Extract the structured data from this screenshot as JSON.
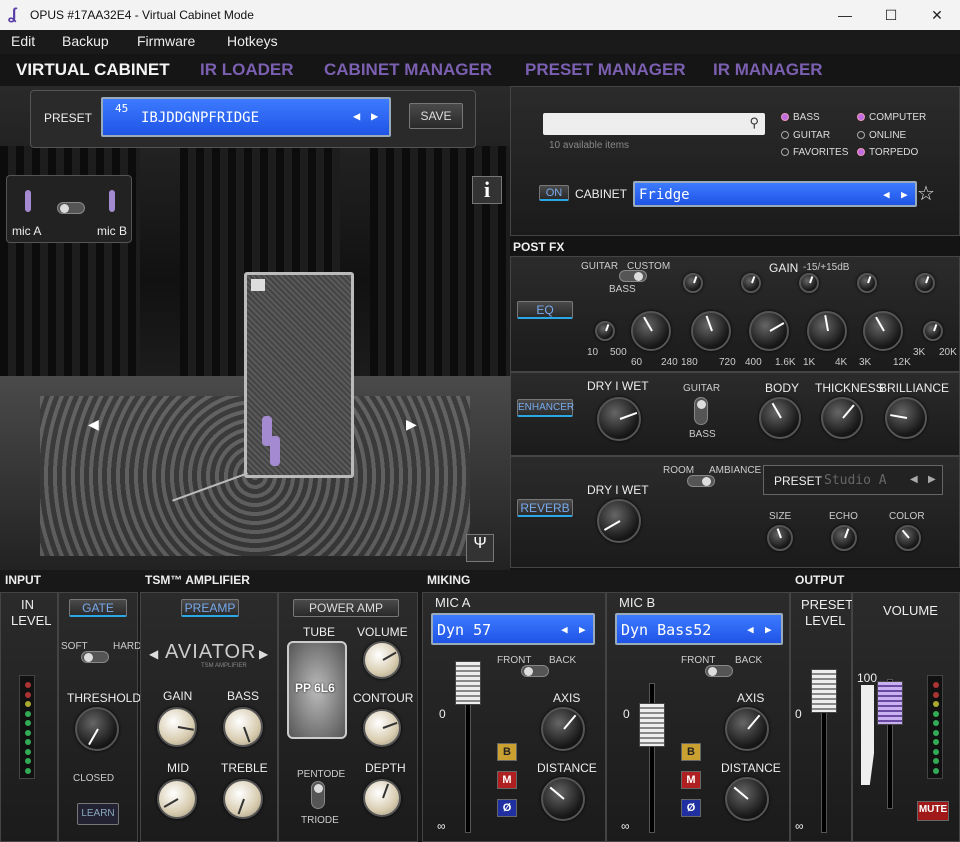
{
  "window": {
    "title": "OPUS #17AA32E4 - Virtual Cabinet Mode",
    "minimize": "—",
    "maximize": "☐",
    "close": "✕"
  },
  "menu": [
    "Edit",
    "Backup",
    "Firmware",
    "Hotkeys"
  ],
  "tabs": [
    "VIRTUAL CABINET",
    "IR LOADER",
    "CABINET MANAGER",
    "PRESET MANAGER",
    "IR MANAGER"
  ],
  "preset": {
    "label": "PRESET",
    "number": "45",
    "name": "IBJDDGNPFRIDGE",
    "save": "SAVE"
  },
  "mics": {
    "a": "mic A",
    "b": "mic B"
  },
  "info": "i",
  "cabinet": {
    "search_placeholder": "",
    "count": "10 available items",
    "filters": [
      "BASS",
      "GUITAR",
      "FAVORITES",
      "COMPUTER",
      "ONLINE",
      "TORPEDO"
    ],
    "on": "ON",
    "label": "CABINET",
    "name": "Fridge",
    "star": "☆"
  },
  "postfx": {
    "title": "POST FX",
    "eq": {
      "button": "EQ",
      "guitar": "GUITAR",
      "custom": "CUSTOM",
      "bass": "BASS",
      "gain": "GAIN",
      "gain_range": "-15/+15dB",
      "freqs": [
        "10",
        "500",
        "60",
        "240",
        "180",
        "720",
        "400",
        "1.6K",
        "1K",
        "4K",
        "3K",
        "12K",
        "3K",
        "20K"
      ]
    },
    "enhancer": {
      "button": "ENHANCER",
      "drywet": "DRY I WET",
      "guitar": "GUITAR",
      "bass": "BASS",
      "body": "BODY",
      "thickness": "THICKNESS",
      "brilliance": "BRILLIANCE"
    },
    "reverb": {
      "button": "REVERB",
      "drywet": "DRY I WET",
      "room": "ROOM",
      "ambiance": "AMBIANCE",
      "preset_label": "PRESET",
      "preset": "Studio A",
      "size": "SIZE",
      "echo": "ECHO",
      "color": "COLOR"
    }
  },
  "input": {
    "title": "INPUT",
    "in": "IN",
    "level": "LEVEL",
    "gate": "GATE",
    "soft": "SOFT",
    "hard": "HARD",
    "threshold": "THRESHOLD",
    "closed": "CLOSED",
    "learn": "LEARN"
  },
  "amp": {
    "title": "TSM™ AMPLIFIER",
    "preamp": "PREAMP",
    "power": "POWER AMP",
    "model": "AVIATOR",
    "model_sub": "TSM AMPLIFIER",
    "gain": "GAIN",
    "bass": "BASS",
    "mid": "MID",
    "treble": "TREBLE",
    "tube": "TUBE",
    "tube_name": "PP 6L6",
    "volume": "VOLUME",
    "contour": "CONTOUR",
    "depth": "DEPTH",
    "pentode": "PENTODE",
    "triode": "TRIODE"
  },
  "miking": {
    "title": "MIKING",
    "a": {
      "label": "MIC A",
      "model": "Dyn 57",
      "front": "FRONT",
      "back": "BACK",
      "axis": "AXIS",
      "distance": "DISTANCE",
      "zero": "0",
      "inf": "∞"
    },
    "b": {
      "label": "MIC B",
      "model": "Dyn Bass52",
      "front": "FRONT",
      "back": "BACK",
      "axis": "AXIS",
      "distance": "DISTANCE",
      "zero": "0",
      "inf": "∞"
    },
    "buttons": [
      "B",
      "M",
      "Ø"
    ]
  },
  "output": {
    "title": "OUTPUT",
    "preset": "PRESET",
    "level": "LEVEL",
    "volume": "VOLUME",
    "value": "100",
    "zero": "0",
    "inf": "∞",
    "mute": "MUTE"
  },
  "colors": {
    "accent": "#7b5fb0",
    "lcd": "#2f6bf5",
    "cyan": "#2aa8e6"
  }
}
